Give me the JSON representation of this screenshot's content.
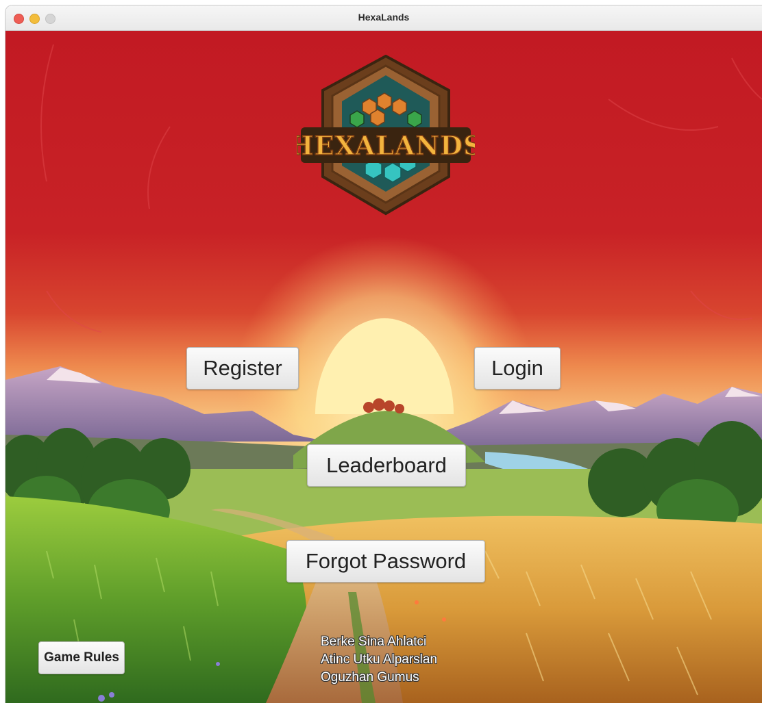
{
  "window": {
    "title": "HexaLands"
  },
  "logo": {
    "text": "HEXALANDS"
  },
  "buttons": {
    "register": "Register",
    "login": "Login",
    "leaderboard": "Leaderboard",
    "forgot_password": "Forgot Password",
    "game_rules": "Game Rules"
  },
  "credits": [
    "Berke Sina Ahlatci",
    "Atinc Utku Alparslan",
    "Oguzhan Gumus"
  ],
  "colors": {
    "sky_top": "#c41a22",
    "sun": "#ffe89a",
    "button_bg": "#f2f2f2"
  }
}
